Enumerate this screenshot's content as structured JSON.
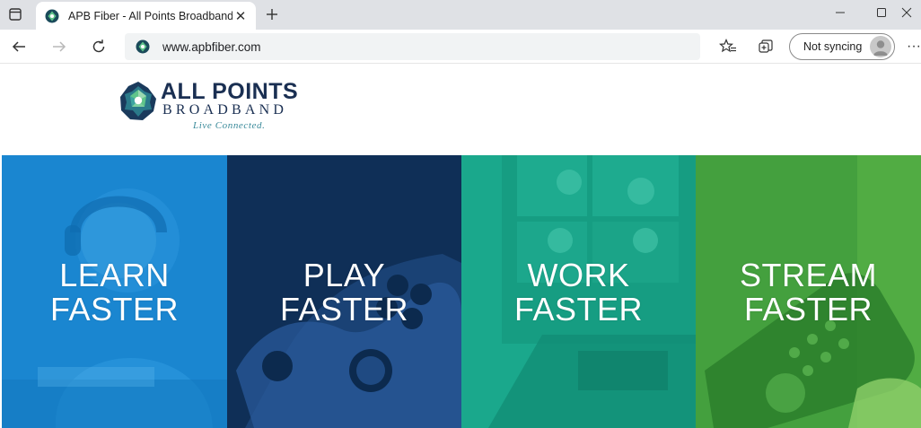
{
  "browser": {
    "tab_title": "APB Fiber - All Points Broadband",
    "url": "www.apbfiber.com",
    "sync_label": "Not syncing"
  },
  "logo": {
    "name": "ALL POINTS",
    "sub": "BROADBAND",
    "tagline": "Live Connected."
  },
  "panels": [
    {
      "line1": "LEARN",
      "line2": "FASTER",
      "color": "#1a86d0"
    },
    {
      "line1": "PLAY",
      "line2": "FASTER",
      "color": "#0f2f57"
    },
    {
      "line1": "WORK",
      "line2": "FASTER",
      "color": "#1aa88c"
    },
    {
      "line1": "STREAM",
      "line2": "FASTER",
      "color": "#3e9a3a"
    }
  ]
}
